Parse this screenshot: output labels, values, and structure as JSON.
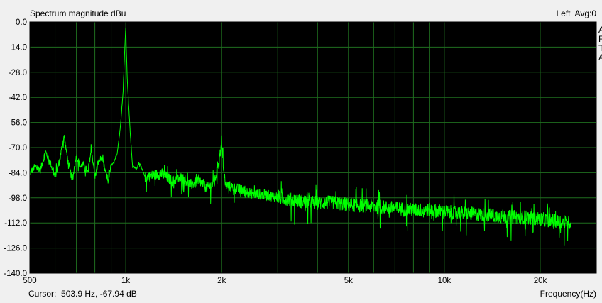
{
  "window": {
    "title": "Spectrum magnitude dBu",
    "channel_label": "Left",
    "avg_label": "Avg:0",
    "side_letters": [
      "A",
      "F",
      "T",
      "A"
    ],
    "cursor_label": "Cursor:",
    "cursor_value": "503.9 Hz, -67.94 dB"
  },
  "colors": {
    "background": "#000000",
    "grid": "#1f6e1f",
    "trace": "#00ff00"
  },
  "chart_data": {
    "type": "line",
    "title": "Spectrum magnitude dBu",
    "xlabel": "Frequency(Hz)",
    "ylabel": "",
    "x_scale": "log",
    "xlim": [
      500,
      30000
    ],
    "ylim": [
      -140,
      0
    ],
    "x_ticks": [
      {
        "value": 500,
        "label": "500"
      },
      {
        "value": 1000,
        "label": "1k"
      },
      {
        "value": 2000,
        "label": "2k"
      },
      {
        "value": 5000,
        "label": "5k"
      },
      {
        "value": 10000,
        "label": "10k"
      },
      {
        "value": 20000,
        "label": "20k"
      }
    ],
    "y_ticks": [
      {
        "value": 0,
        "label": "0.0"
      },
      {
        "value": -14,
        "label": "-14.0"
      },
      {
        "value": -28,
        "label": "-28.0"
      },
      {
        "value": -42,
        "label": "-42.0"
      },
      {
        "value": -56,
        "label": "-56.0"
      },
      {
        "value": -70,
        "label": "-70.0"
      },
      {
        "value": -84,
        "label": "-84.0"
      },
      {
        "value": -98,
        "label": "-98.0"
      },
      {
        "value": -112,
        "label": "-112.0"
      },
      {
        "value": -126,
        "label": "-126.0"
      },
      {
        "value": -140,
        "label": "-140.0"
      }
    ],
    "grid": true,
    "series": [
      {
        "x": [
          500,
          520,
          540,
          560,
          580,
          600,
          620,
          640,
          660,
          680,
          700,
          720,
          740,
          760,
          780,
          800,
          820,
          840,
          860,
          880,
          900,
          920,
          940,
          960,
          980,
          1000,
          1010,
          1030,
          1050,
          1080,
          1100,
          1150,
          1200,
          1300,
          1400,
          1500,
          1600,
          1700,
          1800,
          1900,
          2000,
          2050,
          2200,
          2500,
          2800,
          3000,
          3500,
          4000,
          4500,
          5000,
          6000,
          7000,
          8000,
          9000,
          10000,
          12000,
          14000,
          16000,
          18000,
          20000,
          22000,
          24000,
          25000
        ],
        "y": [
          -84,
          -80,
          -82,
          -72,
          -78,
          -86,
          -77,
          -63,
          -78,
          -88,
          -74,
          -80,
          -79,
          -84,
          -70,
          -86,
          -78,
          -75,
          -82,
          -88,
          -80,
          -78,
          -73,
          -60,
          -40,
          -2,
          -30,
          -58,
          -80,
          -82,
          -78,
          -86,
          -85,
          -84,
          -88,
          -86,
          -90,
          -88,
          -92,
          -89,
          -68,
          -90,
          -92,
          -95,
          -96,
          -97,
          -99,
          -100,
          -100,
          -101,
          -102,
          -103,
          -104,
          -104,
          -105,
          -106,
          -107,
          -108,
          -108,
          -109,
          -110,
          -111,
          -111
        ]
      }
    ]
  }
}
